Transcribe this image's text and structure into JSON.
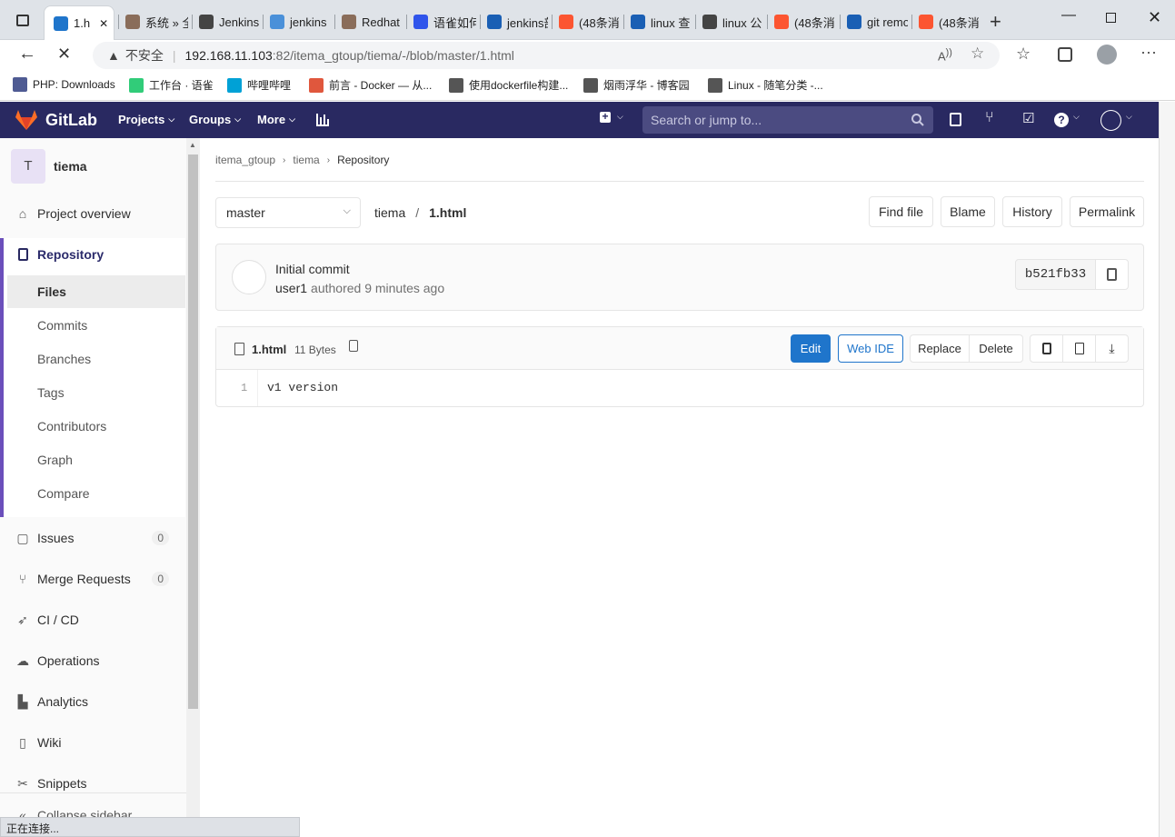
{
  "browser": {
    "tabs": [
      {
        "title": "1.h",
        "color": "#1f75cb"
      },
      {
        "title": "系统 » 全",
        "color": "#8a6d5a"
      },
      {
        "title": "Jenkins",
        "color": "#444"
      },
      {
        "title": "jenkins",
        "color": "#4a90d9"
      },
      {
        "title": "Redhat",
        "color": "#8a6d5a"
      },
      {
        "title": "语雀如何",
        "color": "#2f54eb"
      },
      {
        "title": "jenkins部",
        "color": "#1a5fb4"
      },
      {
        "title": "(48条消",
        "color": "#fc5531"
      },
      {
        "title": "linux 查",
        "color": "#1a5fb4"
      },
      {
        "title": "linux 公",
        "color": "#444"
      },
      {
        "title": "(48条消",
        "color": "#fc5531"
      },
      {
        "title": "git remo",
        "color": "#1a5fb4"
      },
      {
        "title": "(48条消",
        "color": "#fc5531"
      }
    ],
    "insecure_label": "不安全",
    "url_host": "192.168.11.103",
    "url_rest": ":82/itema_gtoup/tiema/-/blob/master/1.html",
    "bookmarks": [
      {
        "label": "PHP: Downloads",
        "color": "#4f5b93"
      },
      {
        "label": "工作台 · 语雀",
        "color": "#31cc79"
      },
      {
        "label": "哔哩哔哩",
        "color": "#00a1d6"
      },
      {
        "label": "前言 - Docker — 从...",
        "color": "#e0573d"
      },
      {
        "label": "使用dockerfile构建...",
        "color": "#555"
      },
      {
        "label": "烟雨浮华 - 博客园",
        "color": "#555"
      },
      {
        "label": "Linux - 随笔分类 -...",
        "color": "#555"
      }
    ],
    "status": "正在连接..."
  },
  "header": {
    "brand": "GitLab",
    "nav": [
      "Projects",
      "Groups",
      "More"
    ],
    "search_placeholder": "Search or jump to..."
  },
  "sidebar": {
    "project_initial": "T",
    "project_name": "tiema",
    "overview": "Project overview",
    "repository": "Repository",
    "repo_sub": [
      "Files",
      "Commits",
      "Branches",
      "Tags",
      "Contributors",
      "Graph",
      "Compare"
    ],
    "issues": "Issues",
    "issues_count": "0",
    "merge_requests": "Merge Requests",
    "mr_count": "0",
    "cicd": "CI / CD",
    "operations": "Operations",
    "analytics": "Analytics",
    "wiki": "Wiki",
    "snippets": "Snippets",
    "collapse": "Collapse sidebar"
  },
  "breadcrumb": [
    "itema_gtoup",
    "tiema",
    "Repository"
  ],
  "file_nav": {
    "branch": "master",
    "path_repo": "tiema",
    "sep": "/",
    "path_file": "1.html",
    "buttons": [
      "Find file",
      "Blame",
      "History",
      "Permalink"
    ]
  },
  "commit": {
    "title": "Initial commit",
    "author": "user1",
    "authored": "authored 9 minutes ago",
    "sha": "b521fb33"
  },
  "file": {
    "name": "1.html",
    "size": "11 Bytes",
    "edit": "Edit",
    "web_ide": "Web IDE",
    "replace": "Replace",
    "delete": "Delete",
    "lines": [
      {
        "num": "1",
        "code": "v1 version"
      }
    ]
  },
  "colors": {
    "header": "#292961",
    "accent": "#1f75cb",
    "active_sidebar": "#6b4fbb"
  }
}
